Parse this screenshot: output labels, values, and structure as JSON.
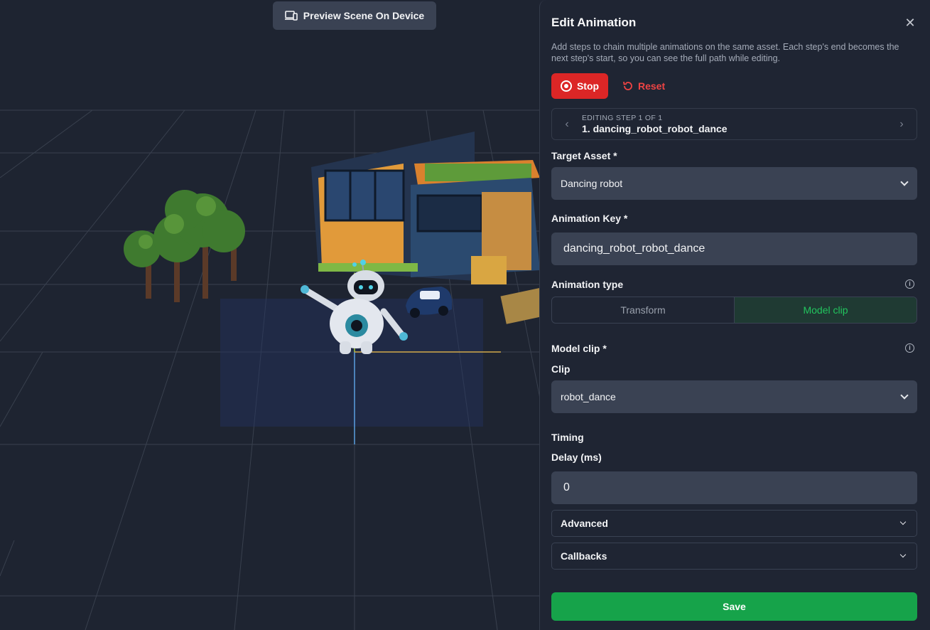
{
  "toolbar": {
    "preview_label": "Preview Scene On Device",
    "preview_icon": "devices-icon"
  },
  "panel": {
    "title": "Edit Animation",
    "description": "Add steps to chain multiple animations on the same asset. Each step's end becomes the next step's start, so you can see the full path while editing.",
    "stop_label": "Stop",
    "reset_label": "Reset",
    "step_caption": "EDITING STEP 1 OF 1",
    "step_name": "1. dancing_robot_robot_dance",
    "target_asset_label": "Target Asset *",
    "target_asset_value": "Dancing robot",
    "animation_key_label": "Animation Key *",
    "animation_key_value": "dancing_robot_robot_dance",
    "animation_type_label": "Animation type",
    "animation_types": [
      "Transform",
      "Model clip"
    ],
    "animation_type_selected": "Model clip",
    "model_clip_label": "Model clip *",
    "clip_label": "Clip",
    "clip_value": "robot_dance",
    "timing_label": "Timing",
    "delay_label": "Delay (ms)",
    "delay_value": "0",
    "advanced_label": "Advanced",
    "callbacks_label": "Callbacks",
    "save_label": "Save"
  },
  "colors": {
    "accent_green": "#16a34a",
    "danger_red": "#dc2626",
    "panel_bg": "#1f2533"
  }
}
